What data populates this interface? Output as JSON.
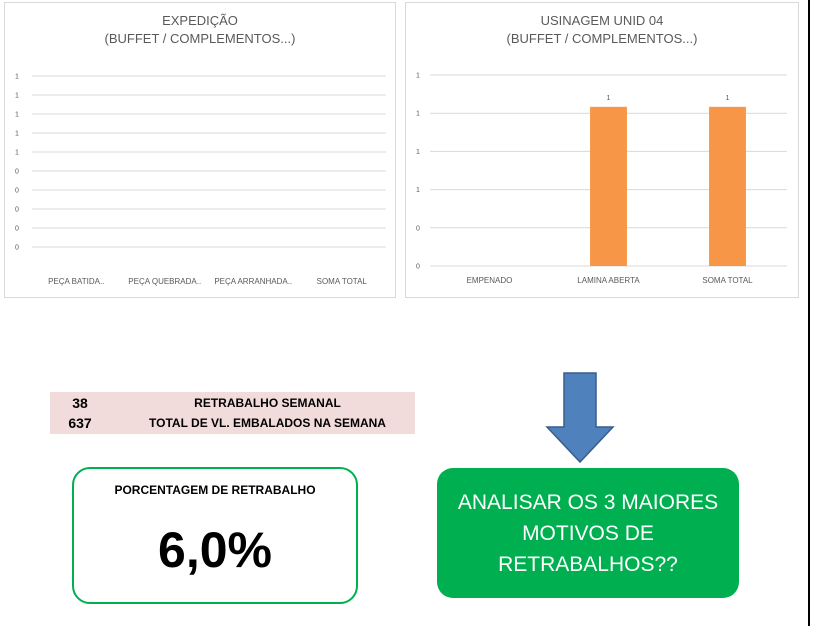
{
  "charts": [
    {
      "title_line1": "EXPEDIÇÃO",
      "title_line2": "(BUFFET / COMPLEMENTOS...)"
    },
    {
      "title_line1": "USINAGEM UNID 04",
      "title_line2": "(BUFFET / COMPLEMENTOS...)"
    }
  ],
  "chart_data": [
    {
      "type": "bar",
      "categories": [
        "PEÇA BATIDA..",
        "PEÇA QUEBRADA..",
        "PEÇA ARRANHADA..",
        "SOMA TOTAL"
      ],
      "values": [
        0,
        0,
        0,
        0
      ],
      "y_tick_labels": [
        "1",
        "1",
        "1",
        "1",
        "1",
        "0",
        "0",
        "0",
        "0",
        "0"
      ],
      "ylim": [
        0,
        1
      ],
      "grid": true,
      "title": "EXPEDIÇÃO (BUFFET / COMPLEMENTOS...)"
    },
    {
      "type": "bar",
      "categories": [
        "EMPENADO",
        "LAMINA ABERTA",
        "SOMA TOTAL"
      ],
      "values": [
        0,
        1,
        1
      ],
      "data_labels": [
        "",
        "1",
        "1"
      ],
      "y_tick_labels": [
        "1",
        "1",
        "1",
        "1",
        "0",
        "0"
      ],
      "ylim": [
        0,
        1.2
      ],
      "grid": true,
      "bar_color": "#f79646",
      "title": "USINAGEM UNID 04 (BUFFET / COMPLEMENTOS...)"
    }
  ],
  "summary": {
    "rows": [
      {
        "value": "38",
        "label": "RETRABALHO SEMANAL"
      },
      {
        "value": "637",
        "label": "TOTAL DE VL. EMBALADOS NA SEMANA"
      }
    ]
  },
  "percentage": {
    "title": "PORCENTAGEM DE RETRABALHO",
    "value": "6,0%"
  },
  "action": {
    "text": "ANALISAR OS 3 MAIORES MOTIVOS DE RETRABALHOS??"
  },
  "colors": {
    "bar": "#f79646",
    "grid": "#d9d9d9",
    "summary_bg": "#f2dcdb",
    "green": "#00b050",
    "arrow": "#4f81bd"
  }
}
